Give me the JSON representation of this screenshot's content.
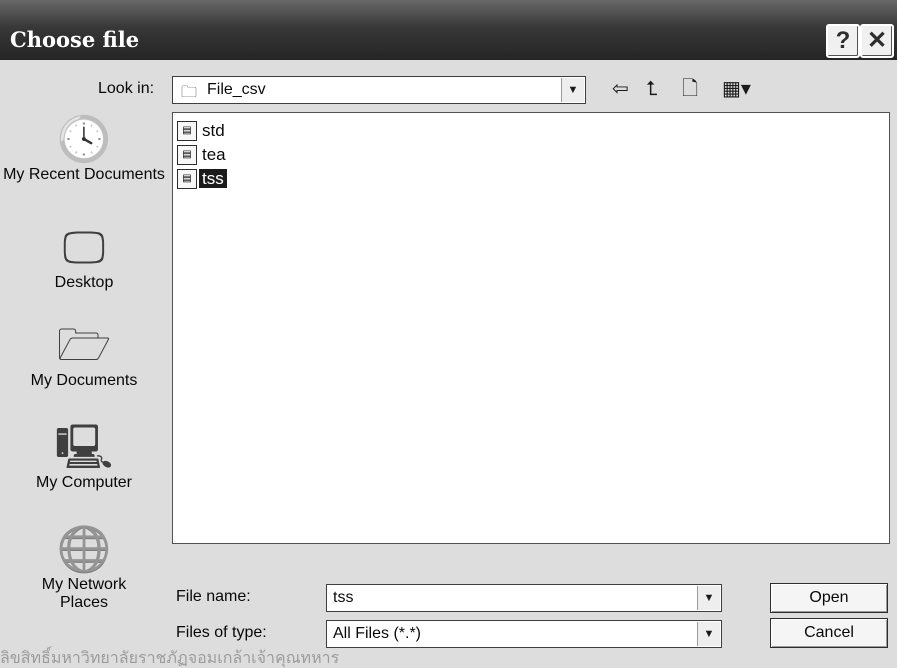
{
  "window": {
    "title": "Choose file",
    "help_label": "?",
    "close_label": "✕"
  },
  "toolbar": {
    "look_in_label": "Look in:",
    "look_in_value": "File_csv",
    "back_icon": "back-arrow-icon",
    "up_icon": "up-folder-icon",
    "new_folder_icon": "new-folder-icon",
    "views_icon": "views-menu-icon"
  },
  "places": [
    {
      "label": "My Recent Documents",
      "icon": "recent-documents-icon"
    },
    {
      "label": "Desktop",
      "icon": "desktop-icon"
    },
    {
      "label": "My Documents",
      "icon": "my-documents-icon"
    },
    {
      "label": "My Computer",
      "icon": "my-computer-icon"
    },
    {
      "label": "My Network Places",
      "icon": "network-places-icon"
    }
  ],
  "files": [
    {
      "name": "std",
      "selected": false
    },
    {
      "name": "tea",
      "selected": false
    },
    {
      "name": "tss",
      "selected": true
    }
  ],
  "form": {
    "file_name_label": "File name:",
    "file_name_value": "tss",
    "file_type_label": "Files of type:",
    "file_type_value": "All Files (*.*)"
  },
  "buttons": {
    "open": "Open",
    "cancel": "Cancel"
  },
  "watermark_text": "ลิขสิทธิ์มหาวิทยาลัยราชภัฏจอมเกล้าเจ้าคุณทหาร"
}
